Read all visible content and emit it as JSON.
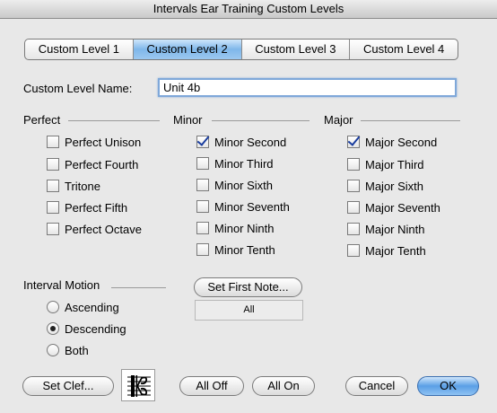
{
  "window": {
    "title": "Intervals Ear Training Custom Levels"
  },
  "tabs": [
    {
      "label": "Custom Level 1",
      "selected": false
    },
    {
      "label": "Custom Level 2",
      "selected": true
    },
    {
      "label": "Custom Level 3",
      "selected": false
    },
    {
      "label": "Custom Level 4",
      "selected": false
    }
  ],
  "name_field": {
    "label": "Custom Level Name:",
    "value": "Unit 4b"
  },
  "groups": {
    "perfect": {
      "title": "Perfect",
      "items": [
        {
          "label": "Perfect Unison",
          "checked": false
        },
        {
          "label": "Perfect Fourth",
          "checked": false
        },
        {
          "label": "Tritone",
          "checked": false
        },
        {
          "label": "Perfect Fifth",
          "checked": false
        },
        {
          "label": "Perfect Octave",
          "checked": false
        }
      ]
    },
    "minor": {
      "title": "Minor",
      "items": [
        {
          "label": "Minor Second",
          "checked": true
        },
        {
          "label": "Minor Third",
          "checked": false
        },
        {
          "label": "Minor Sixth",
          "checked": false
        },
        {
          "label": "Minor Seventh",
          "checked": false
        },
        {
          "label": "Minor Ninth",
          "checked": false
        },
        {
          "label": "Minor Tenth",
          "checked": false
        }
      ]
    },
    "major": {
      "title": "Major",
      "items": [
        {
          "label": "Major Second",
          "checked": true
        },
        {
          "label": "Major Third",
          "checked": false
        },
        {
          "label": "Major Sixth",
          "checked": false
        },
        {
          "label": "Major Seventh",
          "checked": false
        },
        {
          "label": "Major Ninth",
          "checked": false
        },
        {
          "label": "Major Tenth",
          "checked": false
        }
      ]
    }
  },
  "motion": {
    "title": "Interval Motion",
    "options": [
      {
        "label": "Ascending",
        "selected": false
      },
      {
        "label": "Descending",
        "selected": true
      },
      {
        "label": "Both",
        "selected": false
      }
    ]
  },
  "first_note": {
    "button": "Set First Note...",
    "value": "All"
  },
  "buttons": {
    "set_clef": "Set Clef...",
    "all_off": "All Off",
    "all_on": "All On",
    "cancel": "Cancel",
    "ok": "OK"
  },
  "clef_icon": "alto-clef-icon",
  "colors": {
    "selected_tab": "#7fb7ea",
    "default_button": "#5a9fe6",
    "checkmark": "#1a3d9e"
  }
}
